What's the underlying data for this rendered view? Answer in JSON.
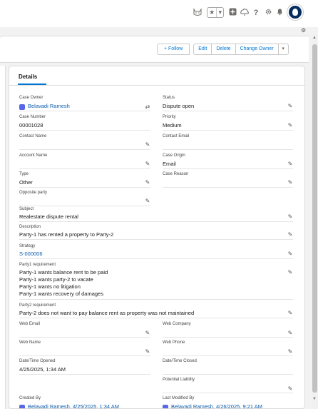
{
  "header": {
    "icons": [
      "cat-face-icon",
      "star-icon",
      "chevron-down-icon",
      "plus-square-icon",
      "cloud-bell-icon",
      "help-icon",
      "gear-icon",
      "bell-icon"
    ],
    "help_glyph": "?"
  },
  "actions": {
    "follow_label": "+ Follow",
    "edit_label": "Edit",
    "delete_label": "Delete",
    "change_owner_label": "Change Owner"
  },
  "card": {
    "tab_label": "Details"
  },
  "fields": {
    "case_owner": {
      "label": "Case Owner",
      "value": "Belavadi Ramesh"
    },
    "status": {
      "label": "Status",
      "value": "Dispute open"
    },
    "case_number": {
      "label": "Case Number",
      "value": "00001028"
    },
    "priority": {
      "label": "Priority",
      "value": "Medium"
    },
    "contact_name": {
      "label": "Contact Name",
      "value": ""
    },
    "contact_email": {
      "label": "Contact Email",
      "value": ""
    },
    "account_name": {
      "label": "Account Name",
      "value": ""
    },
    "case_origin": {
      "label": "Case Origin",
      "value": "Email"
    },
    "type": {
      "label": "Type",
      "value": "Other"
    },
    "case_reason": {
      "label": "Case Reason",
      "value": ""
    },
    "opposite_party": {
      "label": "Opposite party",
      "value": ""
    },
    "subject": {
      "label": "Subject",
      "value": "Realestate dispute rental"
    },
    "description": {
      "label": "Description",
      "value": "Party-1 has rented a property to Party-2"
    },
    "strategy": {
      "label": "Strategy",
      "value": "S-000006"
    },
    "party1_requirement": {
      "label": "Party1 requirement",
      "lines": [
        "Party-1 wants balance rent to be paid",
        "Party-1 wants party-2 to vacate",
        "Party-1 wants no litigation",
        "Party-1 wants recovery of damages"
      ]
    },
    "party2_requirement": {
      "label": "Party2 requirement",
      "value": "Party-2 does not want to pay balance rent as property was not maintained"
    },
    "web_email": {
      "label": "Web Email",
      "value": ""
    },
    "web_company": {
      "label": "Web Company",
      "value": ""
    },
    "web_name": {
      "label": "Web Name",
      "value": ""
    },
    "web_phone": {
      "label": "Web Phone",
      "value": ""
    },
    "date_time_opened": {
      "label": "Date/Time Opened",
      "value": "4/25/2025, 1:34 AM"
    },
    "date_time_closed": {
      "label": "Date/Time Closed",
      "value": ""
    },
    "potential_liability": {
      "label": "Potential Liability",
      "value": ""
    },
    "created_by": {
      "label": "Created By",
      "value": "Belavadi Ramesh, 4/25/2025, 1:34 AM"
    },
    "last_modified_by": {
      "label": "Last Modified By",
      "value": "Belavadi Ramesh, 4/26/2025, 9:21 AM"
    }
  },
  "colors": {
    "link": "#0b5cab",
    "brand": "#0176d3",
    "avatar_bg": "#032d60",
    "user_badge": "#5867e8"
  }
}
